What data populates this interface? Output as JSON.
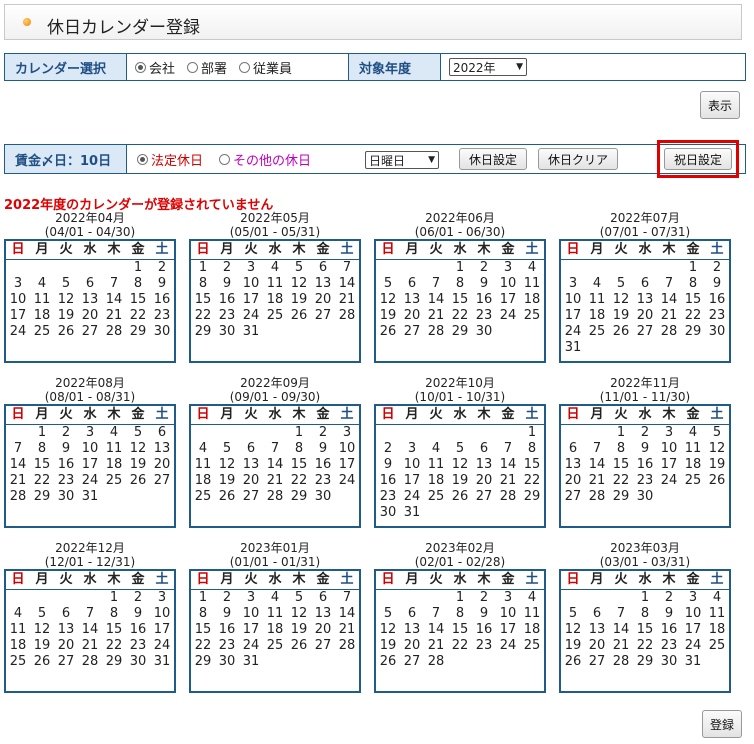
{
  "page_title": "休日カレンダー登録",
  "calendar_select": {
    "label": "カレンダー選択",
    "options": [
      {
        "label": "会社",
        "checked": true
      },
      {
        "label": "部署",
        "checked": false
      },
      {
        "label": "従業員",
        "checked": false
      }
    ],
    "year_label": "対象年度",
    "year_value": "2022年"
  },
  "show_button": "表示",
  "wage": {
    "label": "賃金〆日：10日",
    "holiday_types": [
      {
        "label": "法定休日",
        "checked": true,
        "color": "#d00000"
      },
      {
        "label": "その他の休日",
        "checked": false,
        "color": "#c000c0"
      }
    ],
    "weekday_value": "日曜日",
    "set_holiday_button": "休日設定",
    "clear_holiday_button": "休日クリア",
    "national_holiday_button": "祝日設定"
  },
  "warning": "2022年度のカレンダーが登録されていません",
  "weekdays": [
    "日",
    "月",
    "火",
    "水",
    "木",
    "金",
    "土"
  ],
  "months": [
    {
      "title": "2022年04月",
      "range": "(04/01 - 04/30)",
      "start": 5,
      "days": 30
    },
    {
      "title": "2022年05月",
      "range": "(05/01 - 05/31)",
      "start": 0,
      "days": 31
    },
    {
      "title": "2022年06月",
      "range": "(06/01 - 06/30)",
      "start": 3,
      "days": 30
    },
    {
      "title": "2022年07月",
      "range": "(07/01 - 07/31)",
      "start": 5,
      "days": 31
    },
    {
      "title": "2022年08月",
      "range": "(08/01 - 08/31)",
      "start": 1,
      "days": 31
    },
    {
      "title": "2022年09月",
      "range": "(09/01 - 09/30)",
      "start": 4,
      "days": 30
    },
    {
      "title": "2022年10月",
      "range": "(10/01 - 10/31)",
      "start": 6,
      "days": 31
    },
    {
      "title": "2022年11月",
      "range": "(11/01 - 11/30)",
      "start": 2,
      "days": 30
    },
    {
      "title": "2022年12月",
      "range": "(12/01 - 12/31)",
      "start": 4,
      "days": 31
    },
    {
      "title": "2023年01月",
      "range": "(01/01 - 01/31)",
      "start": 0,
      "days": 31
    },
    {
      "title": "2023年02月",
      "range": "(02/01 - 02/28)",
      "start": 3,
      "days": 28
    },
    {
      "title": "2023年03月",
      "range": "(03/01 - 03/31)",
      "start": 3,
      "days": 31
    }
  ],
  "register_button": "登録"
}
